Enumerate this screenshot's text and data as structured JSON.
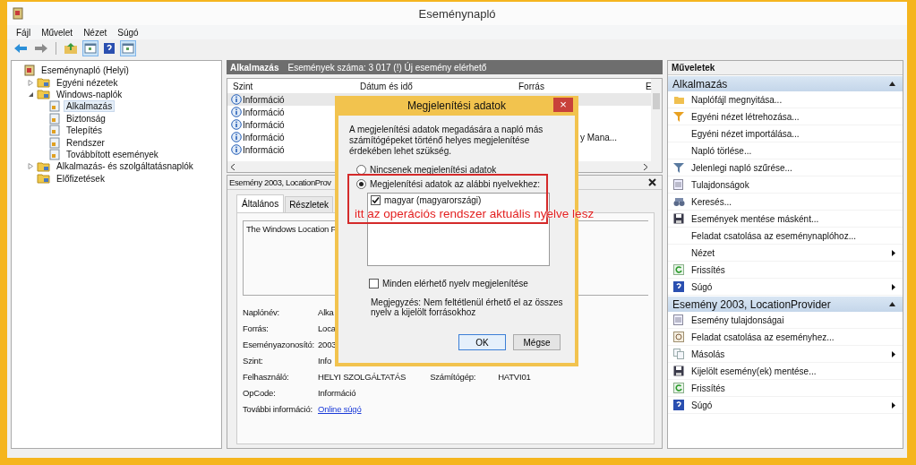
{
  "window": {
    "title": "Eseménynapló"
  },
  "menu": [
    "Fájl",
    "Művelet",
    "Nézet",
    "Súgó"
  ],
  "toolbar": [
    {
      "kind": "back"
    },
    {
      "kind": "forward"
    },
    {
      "kind": "sep"
    },
    {
      "kind": "up"
    },
    {
      "kind": "pane",
      "on": true
    },
    {
      "kind": "help"
    },
    {
      "kind": "pane",
      "on": true
    }
  ],
  "tree": [
    {
      "label": "Eseménynapló (Helyi)",
      "selected": false,
      "children": [
        {
          "label": "Egyéni nézetek",
          "expanded": false,
          "selected": false
        },
        {
          "label": "Windows-naplók",
          "expanded": true,
          "selected": false,
          "children": [
            {
              "label": "Alkalmazás",
              "selected": true
            },
            {
              "label": "Biztonság",
              "selected": false
            },
            {
              "label": "Telepítés",
              "selected": false
            },
            {
              "label": "Rendszer",
              "selected": false
            },
            {
              "label": "Továbbított események",
              "selected": false
            }
          ]
        },
        {
          "label": "Alkalmazás- és szolgáltatásnaplók",
          "expanded": false,
          "selected": false
        },
        {
          "label": "Előfizetések",
          "selected": false
        }
      ]
    }
  ],
  "log_header": {
    "name": "Alkalmazás",
    "info": "Események száma: 3 017 (!) Új esemény elérhető"
  },
  "events": {
    "columns": [
      "Szint",
      "Dátum és idő",
      "Forrás",
      "E"
    ],
    "rows": [
      {
        "severity": "Információ",
        "source": "",
        "selected": true
      },
      {
        "severity": "Információ",
        "source": "",
        "selected": false
      },
      {
        "severity": "Információ",
        "source": "",
        "selected": false
      },
      {
        "severity": "Információ",
        "source": "y Mana...",
        "selected": false
      },
      {
        "severity": "Információ",
        "source": "",
        "selected": false
      }
    ]
  },
  "details": {
    "title": "Esemény 2003, LocationProv",
    "tabs": [
      {
        "label": "Általános",
        "selected": true
      },
      {
        "label": "Részletek",
        "selected": false
      }
    ],
    "description": "The Windows Location P",
    "fields": [
      {
        "label": "Naplónév:",
        "value": "Alka"
      },
      {
        "label": "Forrás:",
        "value": "Loca"
      },
      {
        "label": "Eseményazonosító:",
        "value": "2003"
      },
      {
        "label": "Szint:",
        "value": "Info"
      },
      {
        "label": "Felhasználó:",
        "value": "HELYI SZOLGÁLTATÁS",
        "label2": "Számítógép:",
        "value2": "HATVI01"
      },
      {
        "label": "OpCode:",
        "value": "Információ"
      },
      {
        "label": "További információ:",
        "link": "Online súgó"
      }
    ]
  },
  "actions": {
    "title": "Műveletek",
    "sections": [
      {
        "title": "Alkalmazás",
        "expanded": true,
        "items": [
          {
            "label": "Naplófájl megnyitása...",
            "kind": "open",
            "submenu": false
          },
          {
            "label": "Egyéni nézet létrehozása...",
            "kind": "newfilter",
            "submenu": false
          },
          {
            "label": "Egyéni nézet importálása...",
            "kind": "plain",
            "submenu": false
          },
          {
            "label": "Napló törlése...",
            "kind": "plain",
            "submenu": false
          },
          {
            "label": "Jelenlegi napló szűrése...",
            "kind": "filter",
            "submenu": false
          },
          {
            "label": "Tulajdonságok",
            "kind": "properties",
            "submenu": false
          },
          {
            "label": "Keresés...",
            "kind": "find",
            "submenu": false
          },
          {
            "label": "Események mentése másként...",
            "kind": "save",
            "submenu": false
          },
          {
            "label": "Feladat csatolása az eseménynaplóhoz...",
            "kind": "plain",
            "submenu": false
          },
          {
            "label": "Nézet",
            "kind": "plain",
            "submenu": true
          },
          {
            "label": "Frissítés",
            "kind": "refresh",
            "submenu": false
          },
          {
            "label": "Súgó",
            "kind": "help",
            "submenu": true
          }
        ]
      },
      {
        "title": "Esemény 2003, LocationProvider",
        "expanded": true,
        "items": [
          {
            "label": "Esemény tulajdonságai",
            "kind": "properties",
            "submenu": false
          },
          {
            "label": "Feladat csatolása az eseményhez...",
            "kind": "attach",
            "submenu": false
          },
          {
            "label": "Másolás",
            "kind": "copy",
            "submenu": true
          },
          {
            "label": "Kijelölt esemény(ek) mentése...",
            "kind": "save",
            "submenu": false
          },
          {
            "label": "Frissítés",
            "kind": "refresh",
            "submenu": false
          },
          {
            "label": "Súgó",
            "kind": "help",
            "submenu": true
          }
        ]
      }
    ]
  },
  "dialog": {
    "title": "Megjelenítési adatok",
    "close": "×",
    "text": "A megjelenítési adatok megadására a napló más számítógépeket történő helyes megjelenítése érdekében lehet szükség.",
    "radios": [
      {
        "label": "Nincsenek megjelenítési adatok",
        "selected": false
      },
      {
        "label": "Megjelenítési adatok az alábbi nyelvekhez:",
        "selected": true
      }
    ],
    "languages": [
      {
        "label": "magyar (magyarországi)",
        "checked": true
      }
    ],
    "show_all": {
      "label": "Minden elérhető nyelv megjelenítése",
      "checked": false
    },
    "note": "Megjegyzés: Nem feltétlenül érhető el az összes nyelv a kijelölt forrásokhoz",
    "buttons": [
      {
        "label": "OK",
        "default": true
      },
      {
        "label": "Mégse",
        "default": false
      }
    ]
  },
  "annotation": {
    "text": "itt az operációs rendszer aktuális nyelve lesz"
  }
}
